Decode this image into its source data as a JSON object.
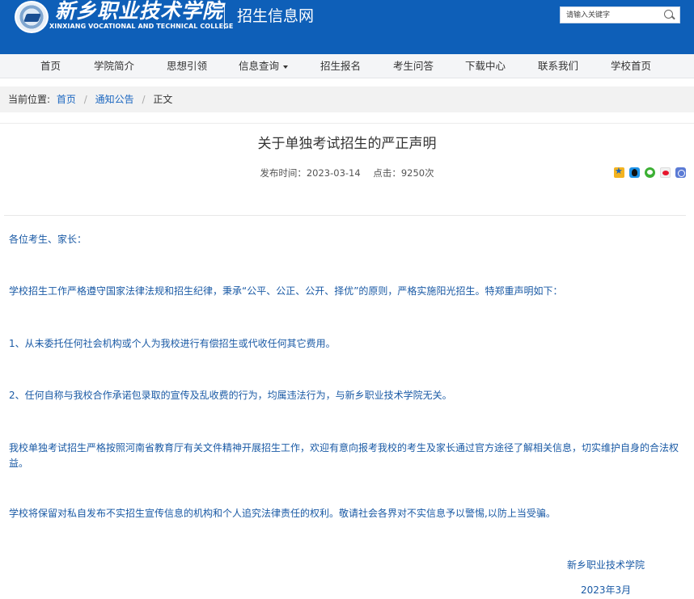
{
  "header": {
    "logo_cn": "新乡职业技术学院",
    "logo_en": "XINXIANG VOCATIONAL AND TECHNICAL COLLEGE",
    "site_name": "招生信息网",
    "search_placeholder": "请输入关键字",
    "bg_color": "#0e5fb8"
  },
  "nav": {
    "items": [
      {
        "label": "首页"
      },
      {
        "label": "学院简介"
      },
      {
        "label": "思想引领"
      },
      {
        "label": "信息查询"
      },
      {
        "label": "招生报名"
      },
      {
        "label": "考生问答"
      },
      {
        "label": "下载中心"
      },
      {
        "label": "联系我们"
      },
      {
        "label": "学校首页"
      }
    ]
  },
  "breadcrumb": {
    "label": "当前位置:",
    "items": [
      "首页",
      "通知公告"
    ],
    "current": "正文"
  },
  "article": {
    "title": "关于单独考试招生的严正声明",
    "publish_time": "发布时间：2023-03-14",
    "clicks": "点击：9250次",
    "paragraphs": [
      "各位考生、家长：",
      "学校招生工作严格遵守国家法律法规和招生纪律，秉承“公平、公正、公开、择优”的原则，严格实施阳光招生。特郑重声明如下：",
      "1、从未委托任何社会机构或个人为我校进行有偿招生或代收任何其它费用。",
      "2、任何自称与我校合作承诺包录取的宣传及乱收费的行为，均属违法行为，与新乡职业技术学院无关。",
      "我校单独考试招生严格按照河南省教育厅有关文件精神开展招生工作，欢迎有意向报考我校的考生及家长通过官方途径了解相关信息，切实维护自身的合法权益。",
      "学校将保留对私自发布不实招生宣传信息的机构和个人追究法律责任的权利。敬请社会各界对不实信息予以警惕,以防上当受骗。"
    ],
    "signature": "新乡职业技术学院",
    "date": "2023年3月",
    "text_color": "#1a5aa5"
  }
}
